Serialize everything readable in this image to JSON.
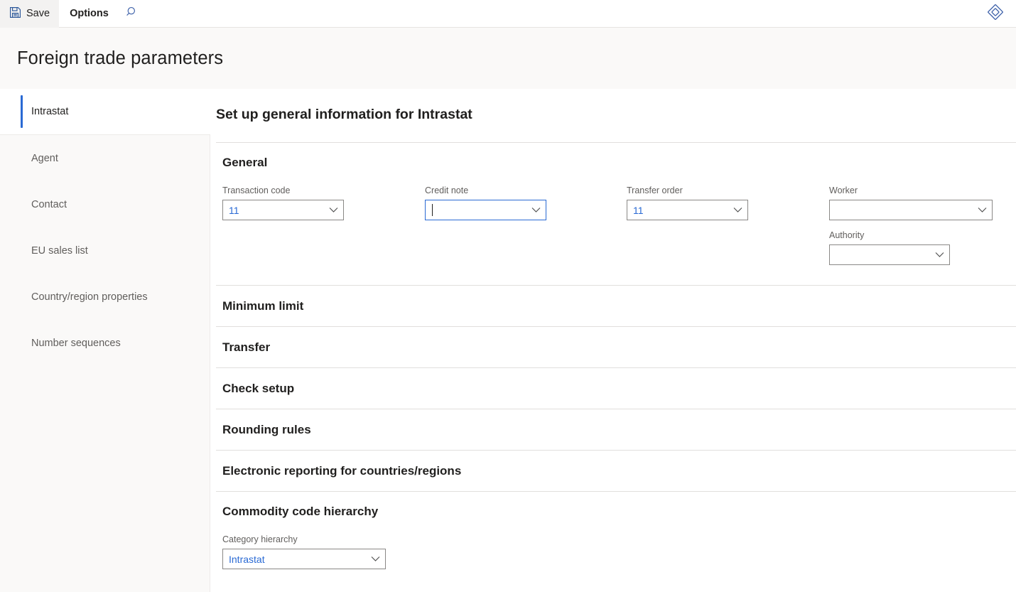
{
  "command_bar": {
    "save_label": "Save",
    "options_label": "Options",
    "search_icon": "search-icon",
    "save_icon": "save-floppy-icon",
    "right_icon": "diamond-settings-icon"
  },
  "page": {
    "title": "Foreign trade parameters"
  },
  "sidebar": {
    "items": [
      {
        "label": "Intrastat",
        "active": true
      },
      {
        "label": "Agent",
        "active": false
      },
      {
        "label": "Contact",
        "active": false
      },
      {
        "label": "EU sales list",
        "active": false
      },
      {
        "label": "Country/region properties",
        "active": false
      },
      {
        "label": "Number sequences",
        "active": false
      }
    ]
  },
  "form": {
    "heading": "Set up general information for Intrastat",
    "general": {
      "title": "General",
      "fields": {
        "transaction_code": {
          "label": "Transaction code",
          "value": "11"
        },
        "credit_note": {
          "label": "Credit note",
          "value": ""
        },
        "transfer_order": {
          "label": "Transfer order",
          "value": "11"
        },
        "worker": {
          "label": "Worker",
          "value": ""
        },
        "authority": {
          "label": "Authority",
          "value": ""
        }
      }
    },
    "collapsed_sections": [
      {
        "title": "Minimum limit"
      },
      {
        "title": "Transfer"
      },
      {
        "title": "Check setup"
      },
      {
        "title": "Rounding rules"
      },
      {
        "title": "Electronic reporting for countries/regions"
      }
    ],
    "commodity": {
      "title": "Commodity code hierarchy",
      "category_hierarchy": {
        "label": "Category hierarchy",
        "value": "Intrastat"
      }
    }
  },
  "colors": {
    "accent_blue": "#2a6ad4",
    "title_text": "#201f1e",
    "muted_text": "#605e5c",
    "divider": "#e1dfdd",
    "band_bg": "#faf9f8"
  }
}
